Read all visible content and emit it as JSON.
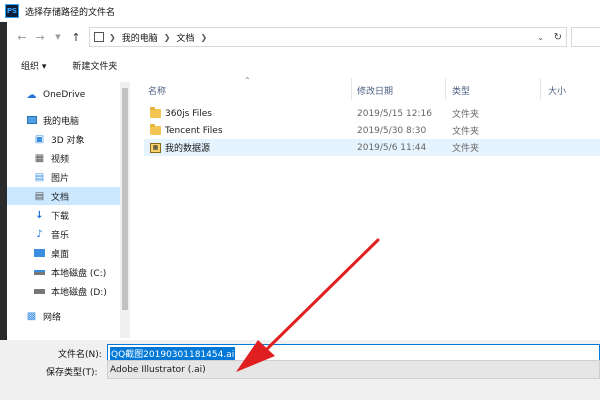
{
  "window": {
    "app_icon": "PS",
    "title": "选择存储路径的文件名"
  },
  "address": {
    "crumbs": [
      "我的电脑",
      "文档"
    ],
    "icons": [
      "back-arrow-icon",
      "forward-arrow-icon",
      "dropdown-icon",
      "up-arrow-icon",
      "pc-icon",
      "refresh-icon"
    ]
  },
  "toolbar": {
    "organize_label": "组织 ▾",
    "new_folder_label": "新建文件夹"
  },
  "nav": {
    "items": [
      {
        "label": "OneDrive",
        "icon": "cloud-icon"
      },
      {
        "label": "我的电脑",
        "icon": "computer-icon"
      },
      {
        "label": "3D 对象",
        "icon": "cube-icon"
      },
      {
        "label": "视频",
        "icon": "video-icon"
      },
      {
        "label": "图片",
        "icon": "picture-icon"
      },
      {
        "label": "文档",
        "icon": "document-icon",
        "selected": true
      },
      {
        "label": "下载",
        "icon": "download-icon"
      },
      {
        "label": "音乐",
        "icon": "music-icon"
      },
      {
        "label": "桌面",
        "icon": "desktop-icon"
      },
      {
        "label": "本地磁盘 (C:)",
        "icon": "drive-icon"
      },
      {
        "label": "本地磁盘 (D:)",
        "icon": "drive-icon"
      },
      {
        "label": "网络",
        "icon": "network-icon"
      }
    ]
  },
  "list": {
    "columns": [
      "名称",
      "修改日期",
      "类型",
      "大小"
    ],
    "rows": [
      {
        "name": "360js Files",
        "date": "2019/5/15 12:16",
        "type": "文件夹",
        "icon": "folder-icon"
      },
      {
        "name": "Tencent Files",
        "date": "2019/5/30 8:30",
        "type": "文件夹",
        "icon": "folder-icon"
      },
      {
        "name": "我的数据源",
        "date": "2019/5/6 11:44",
        "type": "文件夹",
        "icon": "database-folder-icon"
      }
    ]
  },
  "form": {
    "filename_label": "文件名(N):",
    "filename_value": "QQ截图20190301181454.ai",
    "filetype_label": "保存类型(T):",
    "filetype_value": "Adobe Illustrator (.ai)"
  },
  "annotation": {
    "color": "#e02020"
  }
}
